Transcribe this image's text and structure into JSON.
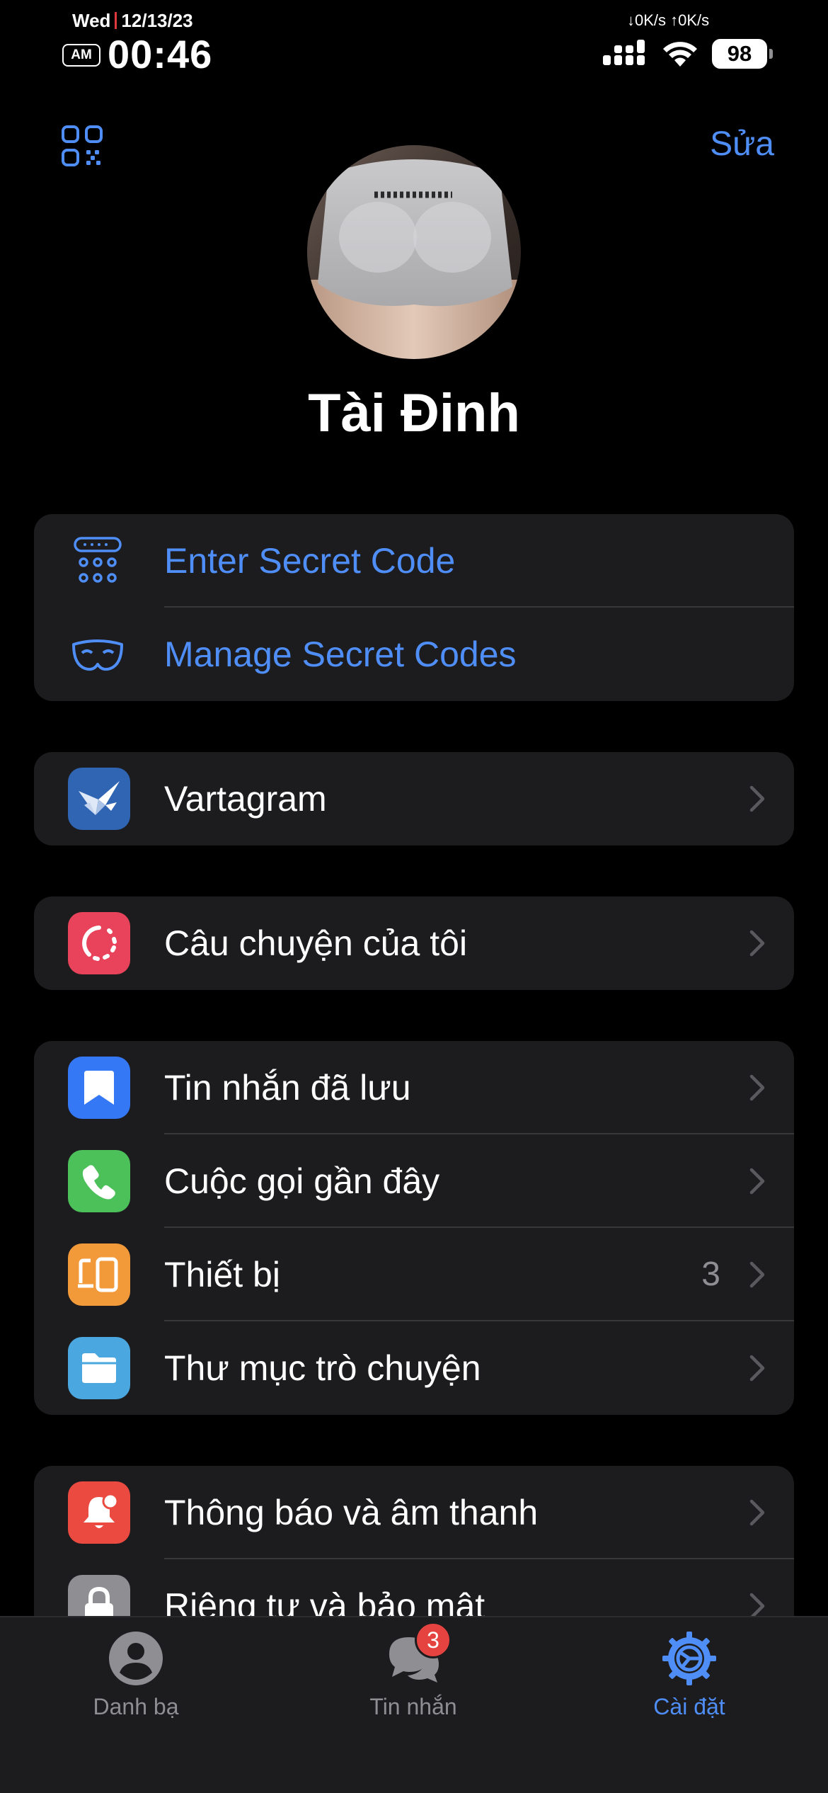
{
  "status_bar": {
    "day": "Wed",
    "date": "12/13/23",
    "am_pm": "AM",
    "time": "00:46",
    "net_speed": "↓0K/s ↑0K/s",
    "battery": "98",
    "icons": [
      "signal-icon",
      "wifi-icon",
      "battery-icon"
    ]
  },
  "header": {
    "qr_icon": "qr-code-icon",
    "edit_label": "Sửa",
    "profile_name": "Tài Đinh"
  },
  "secret_codes": [
    {
      "label": "Enter Secret Code",
      "icon": "keypad-icon"
    },
    {
      "label": "Manage Secret Codes",
      "icon": "mask-icon"
    }
  ],
  "vartagram": {
    "label": "Vartagram",
    "icon": "paper-crane-icon",
    "color": "#2f65b3"
  },
  "stories": {
    "label": "Câu chuyện của tôi",
    "icon": "story-ring-icon",
    "color": "#e8435a"
  },
  "main_group": [
    {
      "label": "Tin nhắn đã lưu",
      "icon": "bookmark-icon",
      "color": "#3478f6",
      "value": ""
    },
    {
      "label": "Cuộc gọi gần đây",
      "icon": "phone-icon",
      "color": "#4cc159",
      "value": ""
    },
    {
      "label": "Thiết bị",
      "icon": "devices-icon",
      "color": "#f2993a",
      "value": "3"
    },
    {
      "label": "Thư mục trò chuyện",
      "icon": "folder-icon",
      "color": "#4aa7e0",
      "value": ""
    }
  ],
  "settings_group": [
    {
      "label": "Thông báo và âm thanh",
      "icon": "bell-icon",
      "color": "#ea4a40"
    },
    {
      "label": "Riêng tư và bảo mật",
      "icon": "lock-icon",
      "color": "#8e8e93"
    }
  ],
  "tab_bar": {
    "tabs": [
      {
        "label": "Danh bạ",
        "icon": "contacts-icon",
        "active": false
      },
      {
        "label": "Tin nhắn",
        "icon": "chats-icon",
        "active": false,
        "badge": "3"
      },
      {
        "label": "Cài đặt",
        "icon": "settings-gear-icon",
        "active": true
      }
    ]
  },
  "colors": {
    "accent": "#4f8ef7",
    "background": "#000000",
    "cell": "#1c1c1e",
    "badge": "#e5433f"
  }
}
